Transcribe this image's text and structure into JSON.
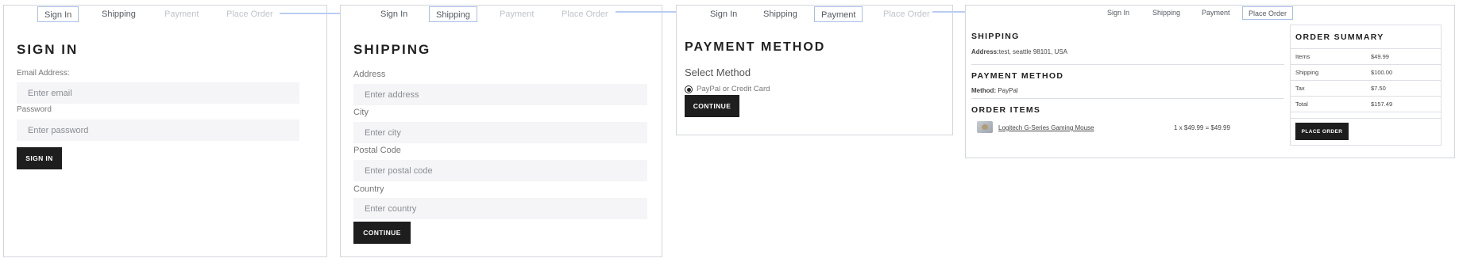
{
  "steps": [
    "Sign In",
    "Shipping",
    "Payment",
    "Place Order"
  ],
  "signin": {
    "title": "SIGN IN",
    "email_label": "Email Address:",
    "email_placeholder": "Enter email",
    "password_label": "Password",
    "password_placeholder": "Enter password",
    "button": "SIGN IN"
  },
  "shipping": {
    "title": "SHIPPING",
    "address_label": "Address",
    "address_placeholder": "Enter address",
    "city_label": "City",
    "city_placeholder": "Enter city",
    "postal_label": "Postal Code",
    "postal_placeholder": "Enter postal code",
    "country_label": "Country",
    "country_placeholder": "Enter country",
    "button": "CONTINUE"
  },
  "payment": {
    "title": "PAYMENT METHOD",
    "subtitle": "Select Method",
    "option": "PayPal or Credit Card",
    "option_checked": true,
    "button": "CONTINUE"
  },
  "placeorder": {
    "shipping_heading": "SHIPPING",
    "address_label": "Address:",
    "address_value": "test, seattle 98101, USA",
    "payment_heading": "PAYMENT METHOD",
    "method_label": "Method:",
    "method_value": "PayPal",
    "items_heading": "ORDER ITEMS",
    "item_name": "Logitech G-Series Gaming Mouse",
    "item_calc": "1 x $49.99 = $49.99",
    "summary_heading": "ORDER SUMMARY",
    "summary": [
      {
        "label": "Items",
        "value": "$49.99"
      },
      {
        "label": "Shipping",
        "value": "$100.00"
      },
      {
        "label": "Tax",
        "value": "$7.50"
      },
      {
        "label": "Total",
        "value": "$157.49"
      }
    ],
    "button": "PLACE ORDER"
  },
  "colors": {
    "accent_border": "#a9bee8",
    "arrow": "#b9cdf2",
    "button_bg": "#1e1e1e"
  }
}
